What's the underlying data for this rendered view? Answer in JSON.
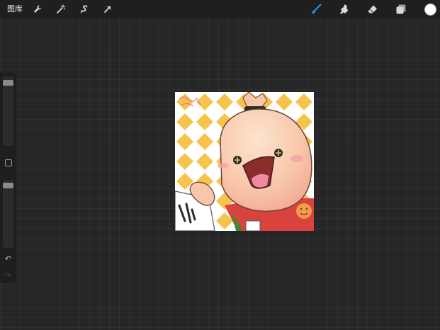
{
  "toolbar": {
    "gallery_label": "图库",
    "left_tools": [
      "wrench-icon",
      "magic-wand-icon",
      "selection-icon",
      "transform-arrow-icon"
    ],
    "right_tools": [
      "brush-icon",
      "smudge-icon",
      "eraser-icon",
      "layers-icon"
    ],
    "active_tool": "brush-icon",
    "active_color": "#ffffff",
    "accent": "#2f8cff"
  },
  "sidebar": {
    "brush_size_level": 0.05,
    "opacity_level": 0.05
  },
  "canvas": {
    "background_colors": [
      "#ffffff",
      "#f7c44b"
    ],
    "character_colors": [
      "#f8c6a8",
      "#e5524f",
      "#f39a4e"
    ]
  }
}
